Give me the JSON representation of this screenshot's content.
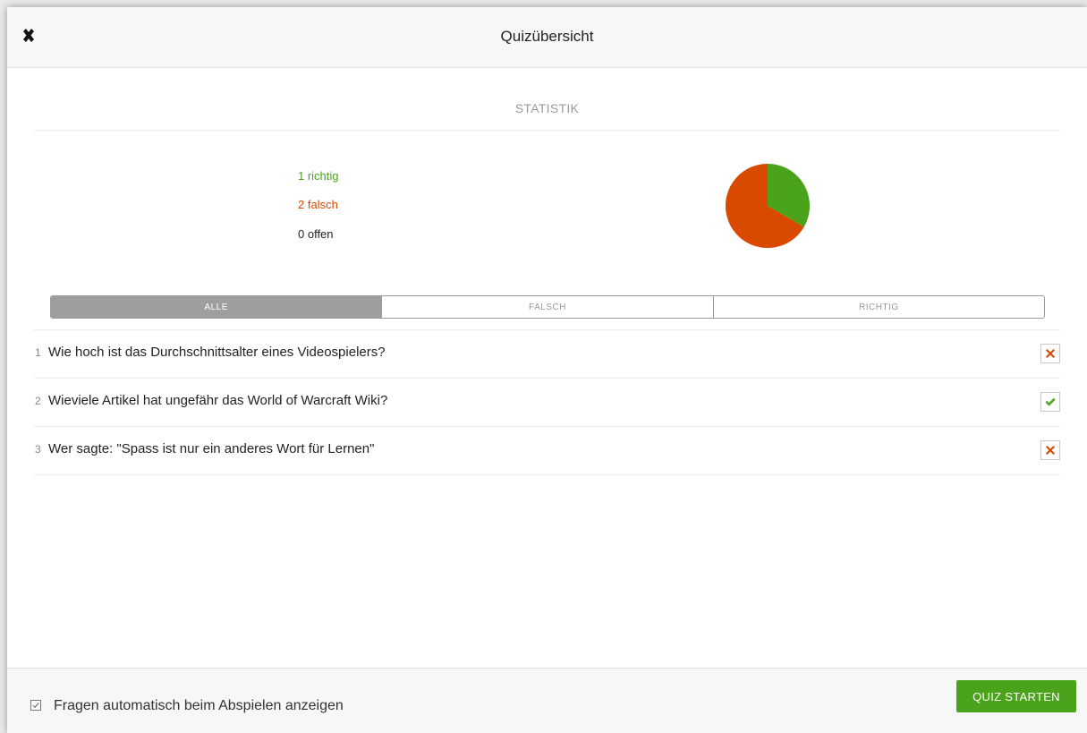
{
  "header": {
    "title": "Quizübersicht",
    "close_icon": "close-icon"
  },
  "statistics": {
    "label": "STATISTIK",
    "correct_text": "1 richtig",
    "wrong_text": "2 falsch",
    "open_text": "0 offen",
    "correct_color": "#4aa31a",
    "wrong_color": "#d84a00"
  },
  "chart_data": {
    "type": "pie",
    "slices": [
      {
        "label": "richtig",
        "value": 1,
        "color": "#4aa31a"
      },
      {
        "label": "falsch",
        "value": 2,
        "color": "#d84a00"
      },
      {
        "label": "offen",
        "value": 0,
        "color": "#222222"
      }
    ]
  },
  "filters": {
    "tabs": [
      {
        "label": "ALLE",
        "active": true
      },
      {
        "label": "FALSCH",
        "active": false
      },
      {
        "label": "RICHTIG",
        "active": false
      }
    ]
  },
  "questions": [
    {
      "number": "1",
      "text": "Wie hoch ist das Durchschnittsalter eines Videospielers?",
      "status": "wrong"
    },
    {
      "number": "2",
      "text": "Wieviele Artikel hat ungefähr das World of Warcraft Wiki?",
      "status": "correct"
    },
    {
      "number": "3",
      "text": "Wer sagte: \"Spass ist nur ein anderes Wort für Lernen\"",
      "status": "wrong"
    }
  ],
  "footer": {
    "auto_show_label": "Fragen automatisch beim Abspielen anzeigen",
    "auto_show_checked": true,
    "start_button_label": "QUIZ STARTEN"
  }
}
